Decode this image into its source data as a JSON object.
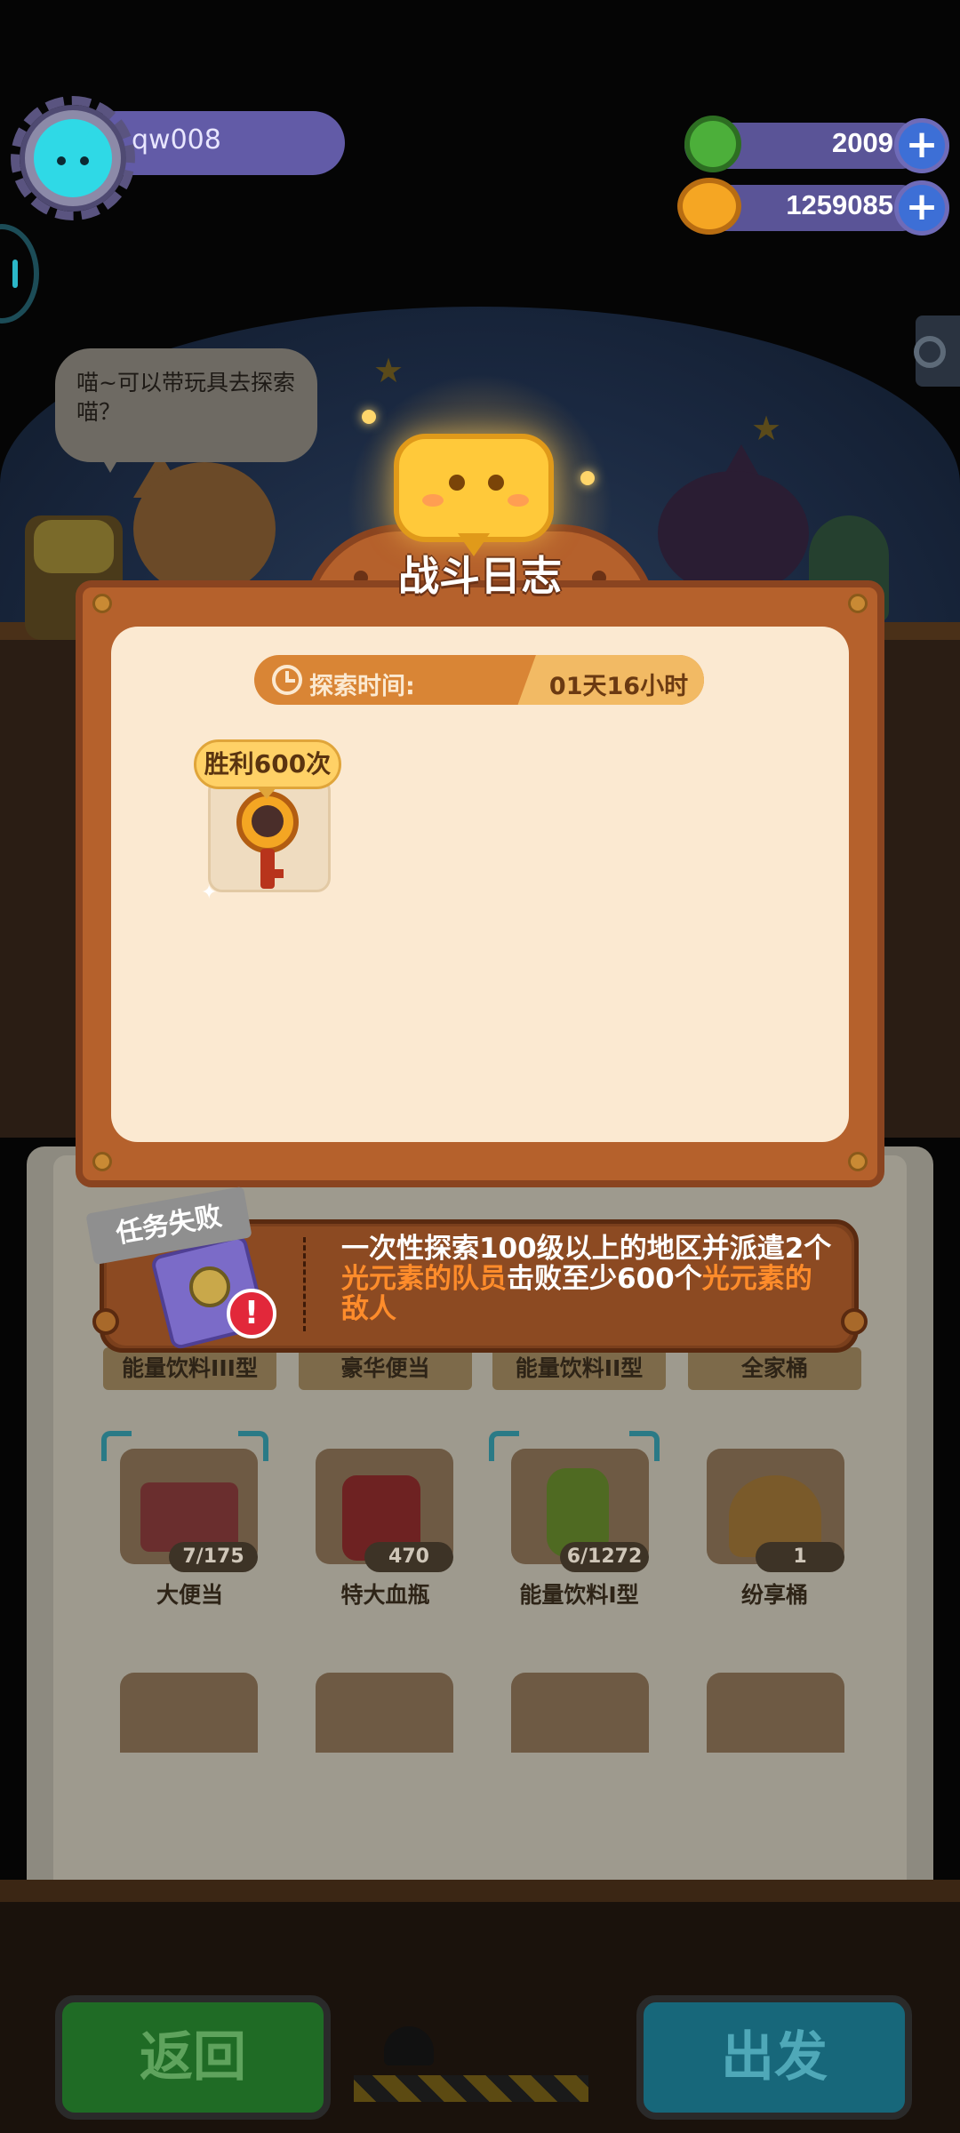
{
  "player": {
    "name": "qw008",
    "avatar_icon": "cat-avatar-icon"
  },
  "resources": [
    {
      "icon": "green-gear-coin-icon",
      "value": "2009",
      "color": "#4caf3a",
      "add_icon": "plus-icon"
    },
    {
      "icon": "orange-planet-coin-icon",
      "value": "1259085",
      "color": "#f5a623",
      "add_icon": "plus-icon"
    }
  ],
  "scene": {
    "speech": "喵~可以带玩具去探索喵？"
  },
  "modal": {
    "title": "战斗日志",
    "time_label": "探索时间:",
    "time_value": "01天16小时",
    "reward_tag": "胜利600次",
    "reward_icon": "key-icon"
  },
  "mission": {
    "status": "任务失败",
    "text_parts": {
      "p1": "一次性探索100级以上的地区并派遣2个",
      "h1": "光元素的队员",
      "p2": "击败至少600个",
      "h2": "光元素的敌人"
    },
    "highlight_color": "#ff8c2b",
    "alert": "!"
  },
  "inventory": {
    "row1_labels": [
      "能量饮料III型",
      "豪华便当",
      "能量饮料II型",
      "全家桶"
    ],
    "row2": [
      {
        "name": "大便当",
        "count": "7/175",
        "icon": "bento-box-icon"
      },
      {
        "name": "特大血瓶",
        "count": "470",
        "icon": "red-potion-icon"
      },
      {
        "name": "能量饮料I型",
        "count": "6/1272",
        "icon": "green-bottle-icon"
      },
      {
        "name": "纷享桶",
        "count": "1",
        "icon": "chicken-bucket-icon"
      }
    ]
  },
  "buttons": {
    "back": "返回",
    "go": "出发"
  }
}
